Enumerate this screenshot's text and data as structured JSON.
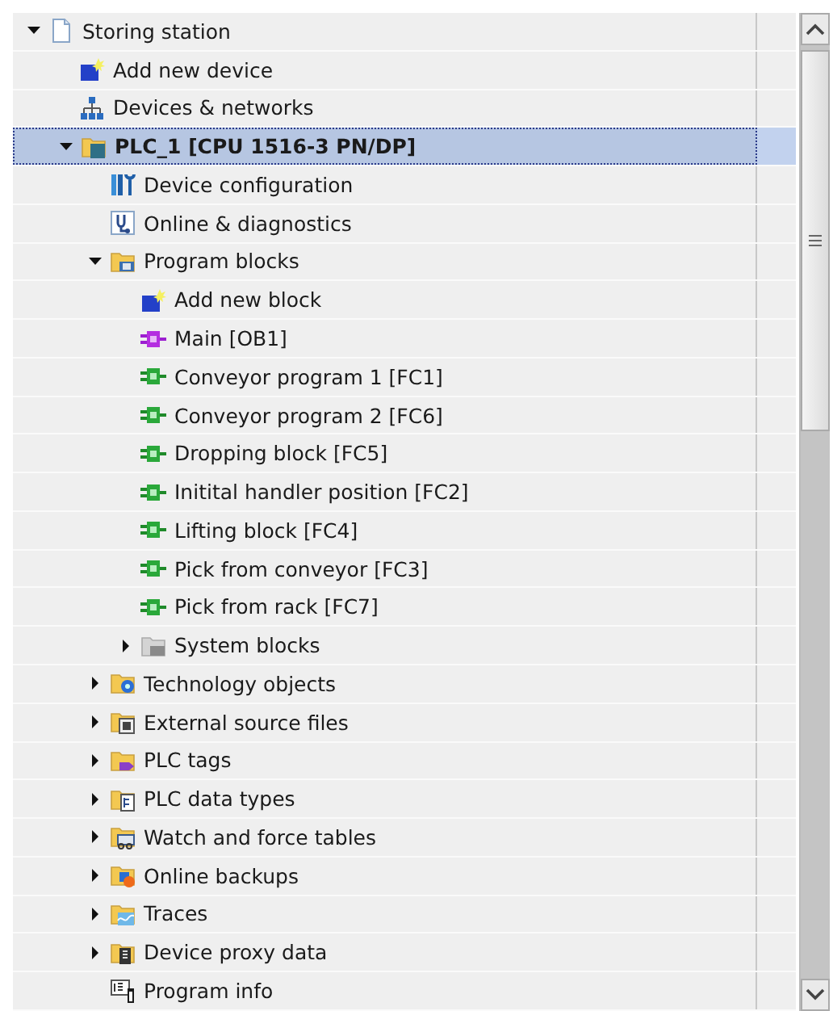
{
  "tree": [
    {
      "label": "Storing station",
      "kind": "project",
      "expanded": true,
      "selected": false,
      "children": [
        {
          "label": "Add new device",
          "kind": "adddevice",
          "selected": false
        },
        {
          "label": "Devices & networks",
          "kind": "network",
          "selected": false
        },
        {
          "label": "PLC_1 [CPU 1516-3 PN/DP]",
          "kind": "plc",
          "expanded": true,
          "selected": true,
          "children": [
            {
              "label": "Device configuration",
              "kind": "config",
              "selected": false
            },
            {
              "label": "Online & diagnostics",
              "kind": "diagnostics",
              "selected": false
            },
            {
              "label": "Program blocks",
              "kind": "blocks",
              "expanded": true,
              "selected": false,
              "children": [
                {
                  "label": "Add new block",
                  "kind": "addblock",
                  "selected": false
                },
                {
                  "label": "Main [OB1]",
                  "kind": "ob",
                  "selected": false
                },
                {
                  "label": "Conveyor program 1 [FC1]",
                  "kind": "fc",
                  "selected": false
                },
                {
                  "label": "Conveyor program 2 [FC6]",
                  "kind": "fc",
                  "selected": false
                },
                {
                  "label": "Dropping block [FC5]",
                  "kind": "fc",
                  "selected": false
                },
                {
                  "label": "Initital handler position [FC2]",
                  "kind": "fc",
                  "selected": false
                },
                {
                  "label": "Lifting block [FC4]",
                  "kind": "fc",
                  "selected": false
                },
                {
                  "label": "Pick from conveyor [FC3]",
                  "kind": "fc",
                  "selected": false
                },
                {
                  "label": "Pick from rack [FC7]",
                  "kind": "fc",
                  "selected": false
                },
                {
                  "label": "System blocks",
                  "kind": "systemfolder",
                  "expanded": false,
                  "selected": false
                }
              ]
            },
            {
              "label": "Technology objects",
              "kind": "techfolder",
              "expanded": false,
              "selected": false
            },
            {
              "label": "External source files",
              "kind": "sourcefolder",
              "expanded": false,
              "selected": false
            },
            {
              "label": "PLC tags",
              "kind": "tagfolder",
              "expanded": false,
              "selected": false
            },
            {
              "label": "PLC data types",
              "kind": "typefolder",
              "expanded": false,
              "selected": false
            },
            {
              "label": "Watch and force tables",
              "kind": "watchfolder",
              "expanded": false,
              "selected": false
            },
            {
              "label": "Online backups",
              "kind": "backupfolder",
              "expanded": false,
              "selected": false
            },
            {
              "label": "Traces",
              "kind": "tracefolder",
              "expanded": false,
              "selected": false
            },
            {
              "label": "Device proxy data",
              "kind": "proxyfolder",
              "expanded": false,
              "selected": false
            },
            {
              "label": "Program info",
              "kind": "info",
              "selected": false
            }
          ]
        }
      ]
    }
  ]
}
